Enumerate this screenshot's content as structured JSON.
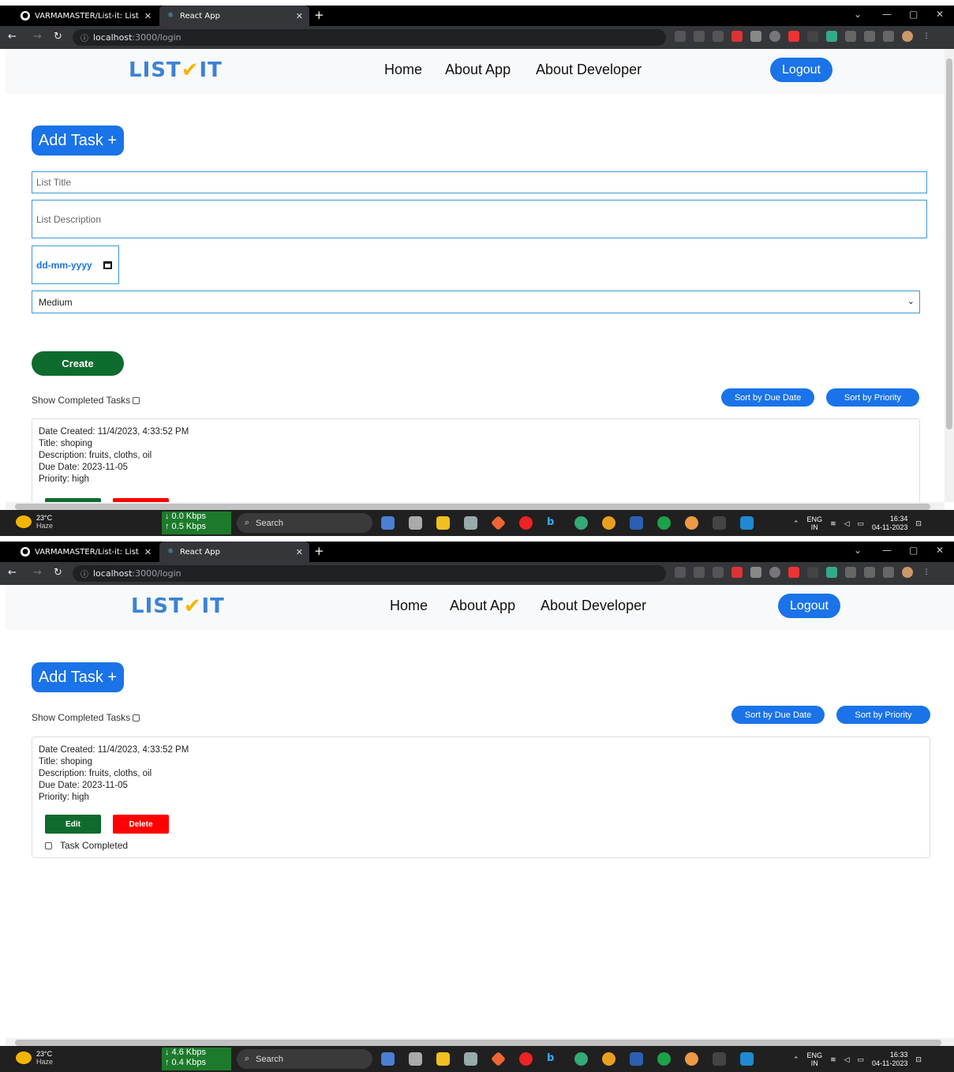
{
  "browser": {
    "tab1_title": "VARMAMASTER/List-it: List it is",
    "tab2_title": "React App",
    "url_host": "localhost",
    "url_path": ":3000/login"
  },
  "app": {
    "logo_text_1": "LIST",
    "logo_check": "✔",
    "logo_text_2": "IT",
    "nav": {
      "home": "Home",
      "about_app": "About App",
      "about_developer": "About Developer"
    },
    "logout_label": "Logout",
    "add_task_label": "Add Task +",
    "form": {
      "title_placeholder": "List Title",
      "description_placeholder": "List Description",
      "date_placeholder": "dd-mm-yyyy",
      "priority_value": "Medium",
      "create_label": "Create"
    },
    "show_completed_label": "Show Completed Tasks",
    "sort_due_label": "Sort by Due Date",
    "sort_priority_label": "Sort by Priority",
    "task": {
      "date_created": "Date Created: 11/4/2023, 4:33:52 PM",
      "title": "Title: shoping",
      "description": "Description: fruits, cloths, oil",
      "due_date": "Due Date: 2023-11-05",
      "priority": "Priority: high",
      "edit_label": "Edit",
      "delete_label": "Delete",
      "completed_label": "Task Completed"
    }
  },
  "taskbar": {
    "temp": "23°C",
    "weather": "Haze",
    "search_label": "Search",
    "lang_1": "ENG",
    "lang_2": "IN",
    "shot1": {
      "down": "↓ 0.0 Kbps",
      "up": "↑ 0.5 Kbps",
      "time": "16:34",
      "date": "04-11-2023"
    },
    "shot2": {
      "down": "↓ 4.6 Kbps",
      "up": "↑ 0.4 Kbps",
      "time": "16:33",
      "date": "04-11-2023"
    }
  },
  "colors": {
    "accent": "#1a73e8",
    "create_green": "#0e6b2e",
    "delete_red": "#ff0000",
    "logo_blue": "#3b82d6",
    "logo_check": "#f5b400"
  }
}
